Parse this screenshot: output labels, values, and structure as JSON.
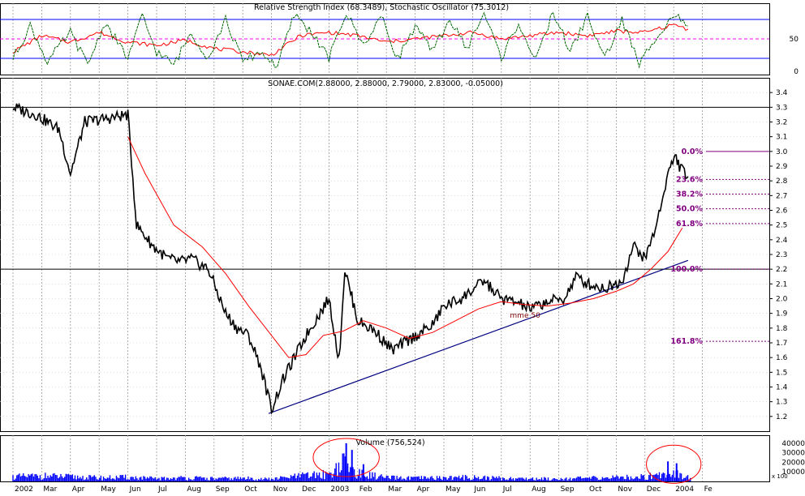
{
  "chart_data": {
    "type": "line",
    "x_months": [
      "2002",
      "Mar",
      "Apr",
      "May",
      "Jun",
      "Jul",
      "Aug",
      "Sep",
      "Oct",
      "Nov",
      "Dec",
      "2003",
      "Feb",
      "Mar",
      "Apr",
      "May",
      "Jun",
      "Jul",
      "Aug",
      "Sep",
      "Oct",
      "Nov",
      "Dec",
      "2004",
      "Fe"
    ],
    "price_pane": {
      "title": "SONAE.COM(2.88000, 2.88000, 2.79000, 2.83000, -0.05000)",
      "ylim": [
        1.1,
        3.5
      ],
      "yticks": [
        "3.4",
        "3.3",
        "3.2",
        "3.1",
        "3.0",
        "2.9",
        "2.8",
        "2.7",
        "2.6",
        "2.5",
        "2.4",
        "2.3",
        "2.2",
        "2.1",
        "2.0",
        "1.9",
        "1.8",
        "1.7",
        "1.6",
        "1.5",
        "1.4",
        "1.3",
        "1.2"
      ],
      "grid": true,
      "series": [
        {
          "name": "SONAE.COM",
          "color": "#000000",
          "x": [
            0,
            0.8,
            1.6,
            2,
            2.5,
            3.2,
            4,
            4.3,
            4.9,
            5.4,
            5.8,
            6.2,
            6.8,
            7.4,
            7.8,
            8.2,
            8.6,
            9,
            9.4,
            10.2,
            11,
            11.35,
            11.55,
            12,
            12.6,
            13.2,
            13.8,
            14.6,
            15,
            15.6,
            16.4,
            17,
            17.6,
            18,
            18.6,
            19.2,
            19.6,
            20,
            20.6,
            21.2,
            21.6,
            22,
            22.4,
            22.8,
            23.05,
            23.2,
            23.5
          ],
          "y": [
            3.3,
            3.25,
            3.15,
            2.85,
            3.2,
            3.22,
            3.25,
            2.5,
            2.35,
            2.27,
            2.25,
            2.27,
            2.2,
            1.9,
            1.8,
            1.75,
            1.55,
            1.25,
            1.45,
            1.75,
            2.0,
            1.58,
            2.2,
            1.85,
            1.78,
            1.65,
            1.72,
            1.82,
            1.95,
            2.0,
            2.12,
            2.0,
            1.97,
            1.93,
            1.98,
            2.0,
            2.15,
            2.1,
            2.07,
            2.12,
            2.36,
            2.27,
            2.5,
            2.85,
            2.97,
            2.9,
            2.83
          ]
        },
        {
          "name": "mme 50",
          "color": "#ff0000",
          "x": [
            4,
            4.6,
            5.6,
            6.6,
            7.4,
            8.2,
            9,
            9.6,
            10.2,
            10.8,
            11.5,
            12.2,
            13,
            13.8,
            14.6,
            15.4,
            16.2,
            17,
            17.8,
            18.6,
            19.4,
            20.2,
            21,
            21.6,
            22.2,
            22.8,
            23.3
          ],
          "y": [
            3.1,
            2.85,
            2.5,
            2.35,
            2.17,
            1.95,
            1.75,
            1.6,
            1.62,
            1.75,
            1.78,
            1.85,
            1.8,
            1.73,
            1.77,
            1.85,
            1.93,
            1.98,
            1.96,
            1.95,
            1.97,
            2.0,
            2.05,
            2.1,
            2.2,
            2.32,
            2.48
          ]
        }
      ],
      "trendline": {
        "from": [
          8.9,
          1.22
        ],
        "to": [
          23.5,
          2.26
        ],
        "color": "#000080"
      },
      "hlines": [
        {
          "y": 3.3,
          "color": "#000000"
        },
        {
          "y": 2.2,
          "color": "#000000"
        }
      ],
      "fibonacci": {
        "color": "#800080",
        "levels": [
          {
            "label": "0.0%",
            "y": 3.0
          },
          {
            "label": "23.6%",
            "y": 2.81
          },
          {
            "label": "38.2%",
            "y": 2.71
          },
          {
            "label": "50.0%",
            "y": 2.61
          },
          {
            "label": "61.8%",
            "y": 2.51
          },
          {
            "label": "100.0%",
            "y": 2.2
          },
          {
            "label": "161.8%",
            "y": 1.71
          }
        ]
      },
      "annotations": [
        {
          "text": "mme 50",
          "x": 17.3,
          "y": 1.87
        }
      ]
    },
    "oscillator_pane": {
      "title": "Relative Strength Index (68.3489), Stochastic Oscillator (75.3012)",
      "ylim": [
        -5,
        105
      ],
      "yticks": [
        "50",
        "0"
      ],
      "bands": [
        {
          "y": 80,
          "color": "#0000ff"
        },
        {
          "y": 20,
          "color": "#0000ff"
        },
        {
          "y": 50,
          "color": "#ff00ff",
          "dashed": true
        }
      ],
      "series": [
        {
          "name": "Relative Strength Index",
          "color": "#ff0000",
          "x": [
            0,
            1,
            2,
            3,
            4,
            5,
            6,
            7,
            8,
            9,
            10,
            11,
            12,
            13,
            14,
            15,
            16,
            17,
            18,
            19,
            20,
            21,
            22,
            23,
            23.5
          ],
          "y": [
            30,
            55,
            45,
            60,
            45,
            40,
            48,
            35,
            30,
            25,
            55,
            60,
            55,
            45,
            50,
            55,
            60,
            50,
            55,
            60,
            55,
            62,
            60,
            72,
            65
          ]
        },
        {
          "name": "Stochastic Oscillator",
          "color": "#008000",
          "x": [
            0,
            0.6,
            1.2,
            2,
            2.6,
            3.2,
            4,
            4.5,
            5,
            5.6,
            6.2,
            6.8,
            7.4,
            8,
            8.6,
            9.2,
            9.8,
            10.4,
            11,
            11.6,
            12.2,
            12.8,
            13.4,
            14,
            14.6,
            15.2,
            15.8,
            16.4,
            17,
            17.6,
            18.2,
            18.8,
            19.4,
            20,
            20.6,
            21.2,
            21.8,
            22.4,
            23,
            23.5
          ],
          "y": [
            20,
            70,
            15,
            60,
            10,
            75,
            20,
            85,
            30,
            10,
            60,
            20,
            80,
            15,
            30,
            8,
            88,
            60,
            20,
            90,
            40,
            85,
            20,
            70,
            30,
            80,
            35,
            90,
            20,
            75,
            15,
            92,
            30,
            85,
            20,
            80,
            10,
            55,
            88,
            70
          ]
        }
      ]
    },
    "volume_pane": {
      "title": "Volume (756,524)",
      "ylim": [
        0,
        45000
      ],
      "yticks": [
        "40000",
        "30000",
        "20000",
        "10000"
      ],
      "unit_label": "x 100",
      "color": "#0000ff",
      "profile_x": [
        0,
        1,
        2,
        3,
        4,
        5,
        6,
        7,
        8,
        9,
        10,
        11,
        11.5,
        12,
        13,
        14,
        15,
        16,
        17,
        18,
        19,
        20,
        21,
        22,
        22.7,
        23,
        23.5
      ],
      "profile_y": [
        5000,
        6000,
        5000,
        4000,
        4500,
        3000,
        4000,
        3000,
        3500,
        2500,
        6000,
        8000,
        20000,
        9000,
        4000,
        3500,
        4000,
        4500,
        3500,
        3000,
        3000,
        3500,
        4500,
        5000,
        9000,
        10000,
        5000
      ],
      "peaks": [
        {
          "x": 11.6,
          "y": 40000
        },
        {
          "x": 11.8,
          "y": 33000
        },
        {
          "x": 12.2,
          "y": 18000
        },
        {
          "x": 22.8,
          "y": 21000
        },
        {
          "x": 23.1,
          "y": 19000
        }
      ]
    },
    "circles": [
      {
        "pane": "volume",
        "cx": 11.6,
        "cy": 25000,
        "rx": 1.15,
        "ry": 20000,
        "color": "#ff0000"
      },
      {
        "pane": "volume",
        "cx": 23.0,
        "cy": 18000,
        "rx": 0.95,
        "ry": 20000,
        "color": "#ff0000"
      }
    ]
  }
}
